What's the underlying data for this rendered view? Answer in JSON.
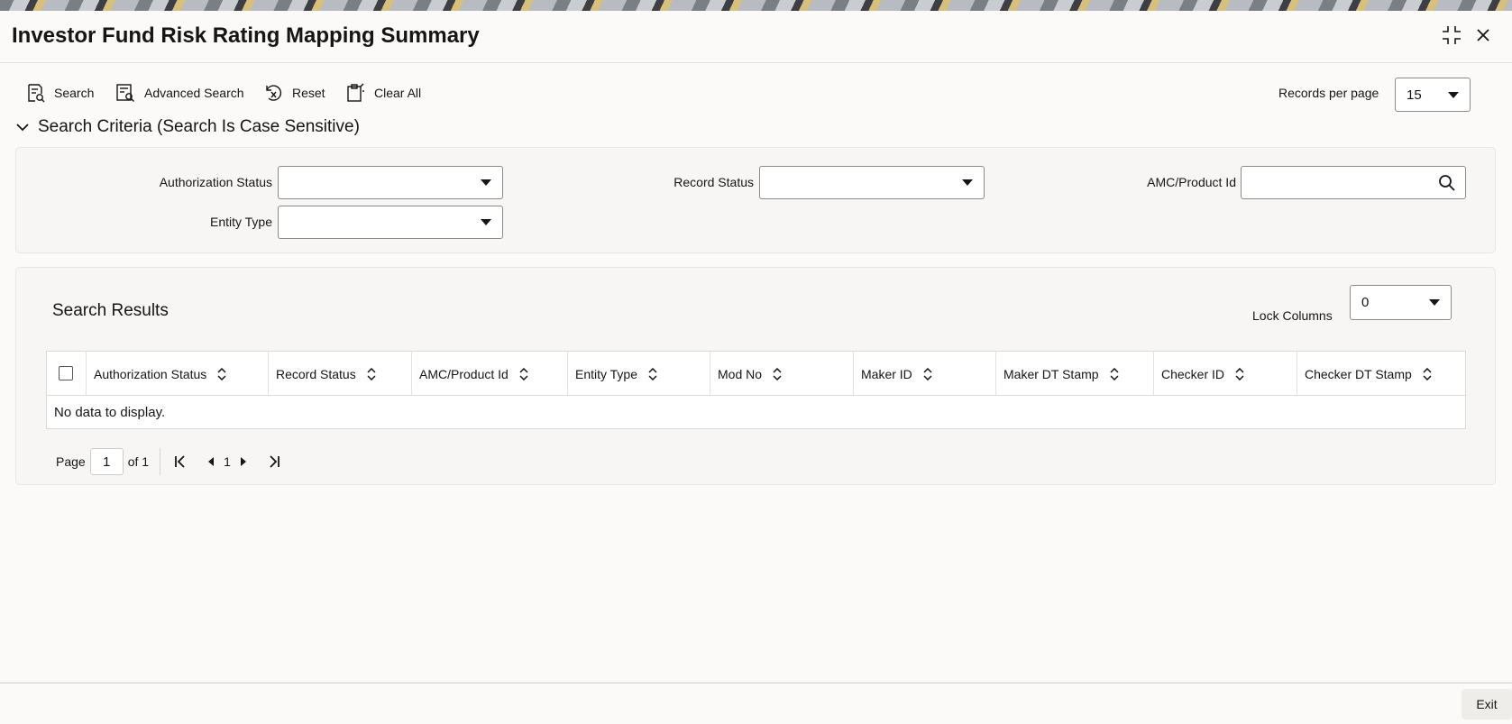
{
  "window": {
    "title": "Investor Fund Risk Rating Mapping Summary",
    "icons": [
      "collapse-icon",
      "close-icon"
    ]
  },
  "toolbar": {
    "search_label": "Search",
    "advanced_search_label": "Advanced Search",
    "reset_label": "Reset",
    "clear_all_label": "Clear All",
    "records_per_page_label": "Records per page",
    "records_per_page_value": "15"
  },
  "criteria": {
    "header": "Search Criteria (Search Is Case Sensitive)",
    "authorization_status_label": "Authorization Status",
    "authorization_status_value": "",
    "record_status_label": "Record Status",
    "record_status_value": "",
    "amc_product_id_label": "AMC/Product Id",
    "amc_product_id_value": "",
    "entity_type_label": "Entity Type",
    "entity_type_value": ""
  },
  "results": {
    "title": "Search Results",
    "lock_columns_label": "Lock Columns",
    "lock_columns_value": "0",
    "columns": [
      "Authorization Status",
      "Record Status",
      "AMC/Product Id",
      "Entity Type",
      "Mod No",
      "Maker ID",
      "Maker DT Stamp",
      "Checker ID",
      "Checker DT Stamp"
    ],
    "empty_message": "No data to display."
  },
  "pager": {
    "page_label": "Page",
    "page_value": "1",
    "of_label": "of 1",
    "current_page": "1"
  },
  "footer": {
    "exit_label": "Exit"
  },
  "colors": {
    "background": "#fbfaf9",
    "panel": "#f7f6f4",
    "border": "#8f8a85",
    "text": "#161513"
  }
}
